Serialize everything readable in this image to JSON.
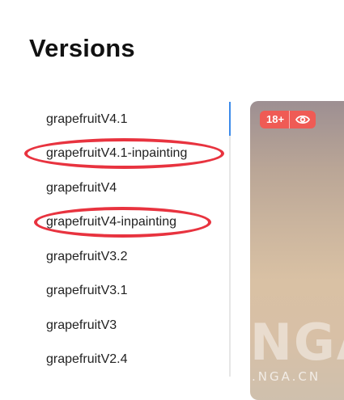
{
  "page": {
    "title": "Versions"
  },
  "versions": [
    {
      "label": "grapefruitV4.1"
    },
    {
      "label": "grapefruitV4.1-inpainting"
    },
    {
      "label": "grapefruitV4"
    },
    {
      "label": "grapefruitV4-inpainting"
    },
    {
      "label": "grapefruitV3.2"
    },
    {
      "label": "grapefruitV3.1"
    },
    {
      "label": "grapefruitV3"
    },
    {
      "label": "grapefruitV2.4"
    }
  ],
  "preview": {
    "badge": "18+",
    "badge_icon": "eye-icon",
    "watermark_large": "NGA",
    "watermark_small": ".NGA.CN"
  },
  "colors": {
    "active_indicator": "#3d8bea",
    "annotation": "#e8333f",
    "badge": "#ef5b55"
  }
}
